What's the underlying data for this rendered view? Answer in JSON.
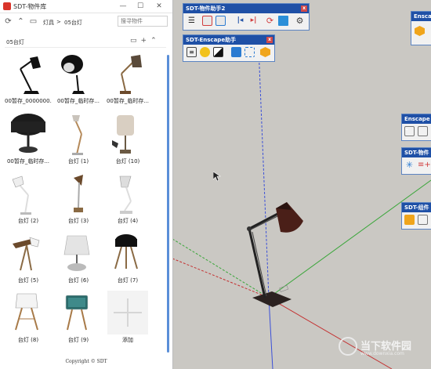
{
  "library": {
    "title": "SDT-物件库",
    "window_buttons": [
      "—",
      "☐",
      "✕"
    ],
    "breadcrumb": [
      "灯具",
      ">",
      "05台灯"
    ],
    "search_placeholder": "搜寻物件",
    "section_title": "05台灯",
    "items": [
      {
        "label": "00暂存_0000000..."
      },
      {
        "label": "00暂存_临时存..."
      },
      {
        "label": "00暂存_临时存..."
      },
      {
        "label": "00暂存_临时存..."
      },
      {
        "label": "台灯 (1)"
      },
      {
        "label": "台灯 (10)"
      },
      {
        "label": "台灯 (2)"
      },
      {
        "label": "台灯 (3)"
      },
      {
        "label": "台灯 (4)"
      },
      {
        "label": "台灯 (5)"
      },
      {
        "label": "台灯 (6)"
      },
      {
        "label": "台灯 (7)"
      },
      {
        "label": "台灯 (8)"
      },
      {
        "label": "台灯 (9)"
      },
      {
        "label": "添加"
      }
    ],
    "copyright": "Copyright © SDT"
  },
  "toolbars": {
    "object_helper": {
      "title": "SDT-物件助手2",
      "close": "x"
    },
    "enscape_helper": {
      "title": "SDT-Enscape助手",
      "close": "x"
    },
    "enscape_right": {
      "title": "Enscape"
    },
    "enscape_c": {
      "title": "Enscape C"
    },
    "sdt_obj_right": {
      "title": "SDT-物件"
    },
    "sdt_group_right": {
      "title": "SDT-组件"
    }
  },
  "watermark": {
    "name": "当下软件园",
    "url": "www.downxia.com"
  },
  "colors": {
    "accent": "#1f50a6",
    "scrollbar": "#5a8fd8"
  }
}
